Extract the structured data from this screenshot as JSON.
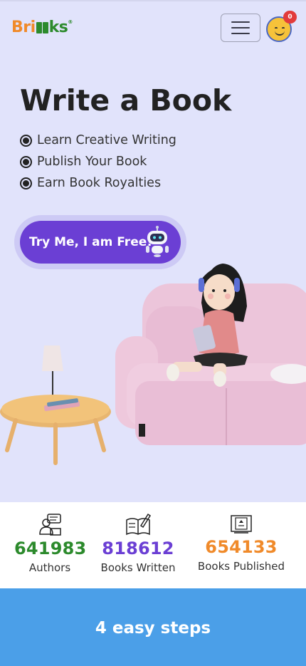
{
  "header": {
    "logo_part1": "Bri",
    "logo_part2": "ks",
    "logo_reg": "®",
    "cart_count": "0"
  },
  "hero": {
    "title": "Write a Book",
    "bullets": [
      "Learn Creative Writing",
      "Publish Your Book",
      "Earn Book Royalties"
    ],
    "cta_label": "Try Me, I am Free!"
  },
  "stats": [
    {
      "value": "641983",
      "label": "Authors",
      "color": "#2c8a2c",
      "icon": "author-icon"
    },
    {
      "value": "818612",
      "label": "Books Written",
      "color": "#6b3fd4",
      "icon": "book-writing-icon"
    },
    {
      "value": "654133",
      "label": "Books Published",
      "color": "#f08a2a",
      "icon": "published-book-icon"
    }
  ],
  "steps": {
    "title": "4 easy steps"
  },
  "colors": {
    "hero_bg": "#e1e3fb",
    "cta_bg": "#6b3fd4",
    "steps_bg": "#4b9fe8"
  }
}
